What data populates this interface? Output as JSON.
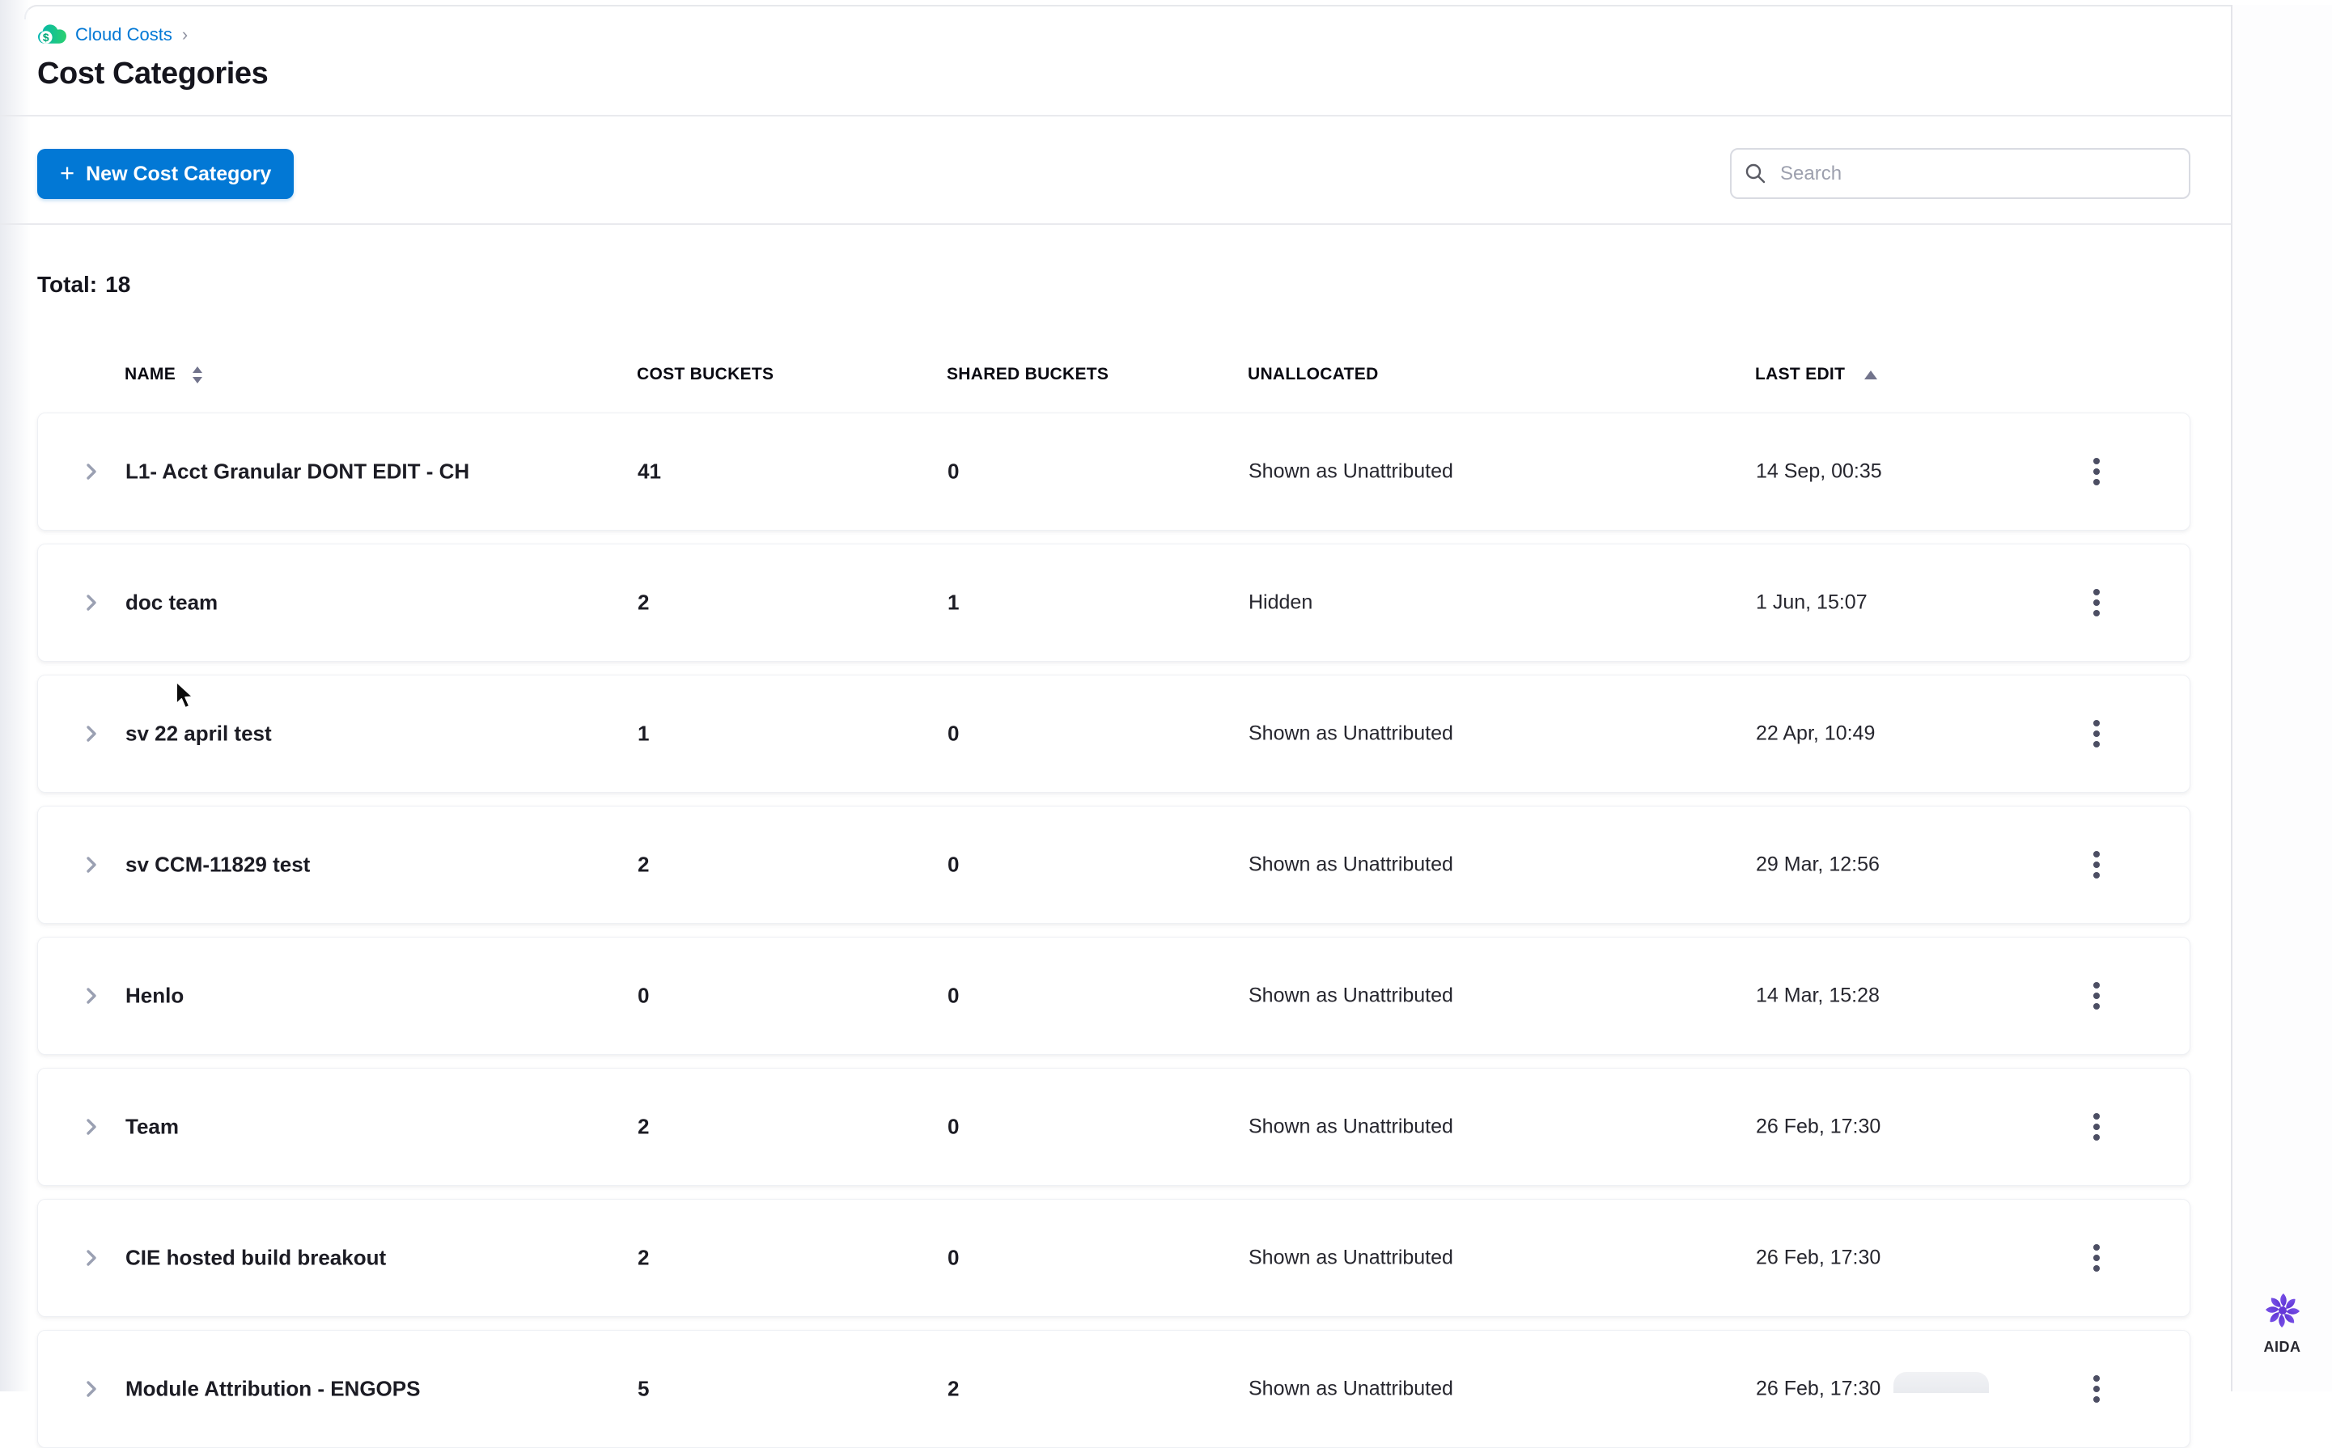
{
  "breadcrumb": {
    "module_label": "Cloud Costs",
    "separator": "›"
  },
  "header": {
    "title": "Cost Categories"
  },
  "toolbar": {
    "new_button_plus": "+",
    "new_button_label": "New Cost Category",
    "search_placeholder": "Search"
  },
  "summary": {
    "total_label": "Total:",
    "total_value": "18"
  },
  "table": {
    "columns": [
      {
        "label": "NAME",
        "sort": "both"
      },
      {
        "label": "COST BUCKETS",
        "sort": "none"
      },
      {
        "label": "SHARED BUCKETS",
        "sort": "none"
      },
      {
        "label": "UNALLOCATED",
        "sort": "none"
      },
      {
        "label": "LAST EDIT",
        "sort": "asc"
      }
    ],
    "rows": [
      {
        "name": "L1- Acct Granular DONT EDIT - CH",
        "cost_buckets": "41",
        "shared_buckets": "0",
        "unallocated": "Shown as Unattributed",
        "last_edit": "14 Sep, 00:35"
      },
      {
        "name": "doc team",
        "cost_buckets": "2",
        "shared_buckets": "1",
        "unallocated": "Hidden",
        "last_edit": "1 Jun, 15:07"
      },
      {
        "name": "sv 22 april test",
        "cost_buckets": "1",
        "shared_buckets": "0",
        "unallocated": "Shown as Unattributed",
        "last_edit": "22 Apr, 10:49"
      },
      {
        "name": "sv CCM-11829 test",
        "cost_buckets": "2",
        "shared_buckets": "0",
        "unallocated": "Shown as Unattributed",
        "last_edit": "29 Mar, 12:56"
      },
      {
        "name": "Henlo",
        "cost_buckets": "0",
        "shared_buckets": "0",
        "unallocated": "Shown as Unattributed",
        "last_edit": "14 Mar, 15:28"
      },
      {
        "name": "Team",
        "cost_buckets": "2",
        "shared_buckets": "0",
        "unallocated": "Shown as Unattributed",
        "last_edit": "26 Feb, 17:30"
      },
      {
        "name": "CIE hosted build breakout",
        "cost_buckets": "2",
        "shared_buckets": "0",
        "unallocated": "Shown as Unattributed",
        "last_edit": "26 Feb, 17:30"
      },
      {
        "name": "Module Attribution - ENGOPS",
        "cost_buckets": "5",
        "shared_buckets": "2",
        "unallocated": "Shown as Unattributed",
        "last_edit": "26 Feb, 17:30"
      }
    ]
  },
  "assistant": {
    "label": "AIDA"
  },
  "colors": {
    "primary_blue": "#0278d5",
    "link_blue": "#0278d5",
    "icon_grey": "#9aa0b2",
    "kebab_grey": "#4c4e63",
    "cloud_costs_teal": "#00b5b1",
    "cloud_costs_green": "#2bd06f",
    "aida_purple": "#6a3bdc"
  }
}
